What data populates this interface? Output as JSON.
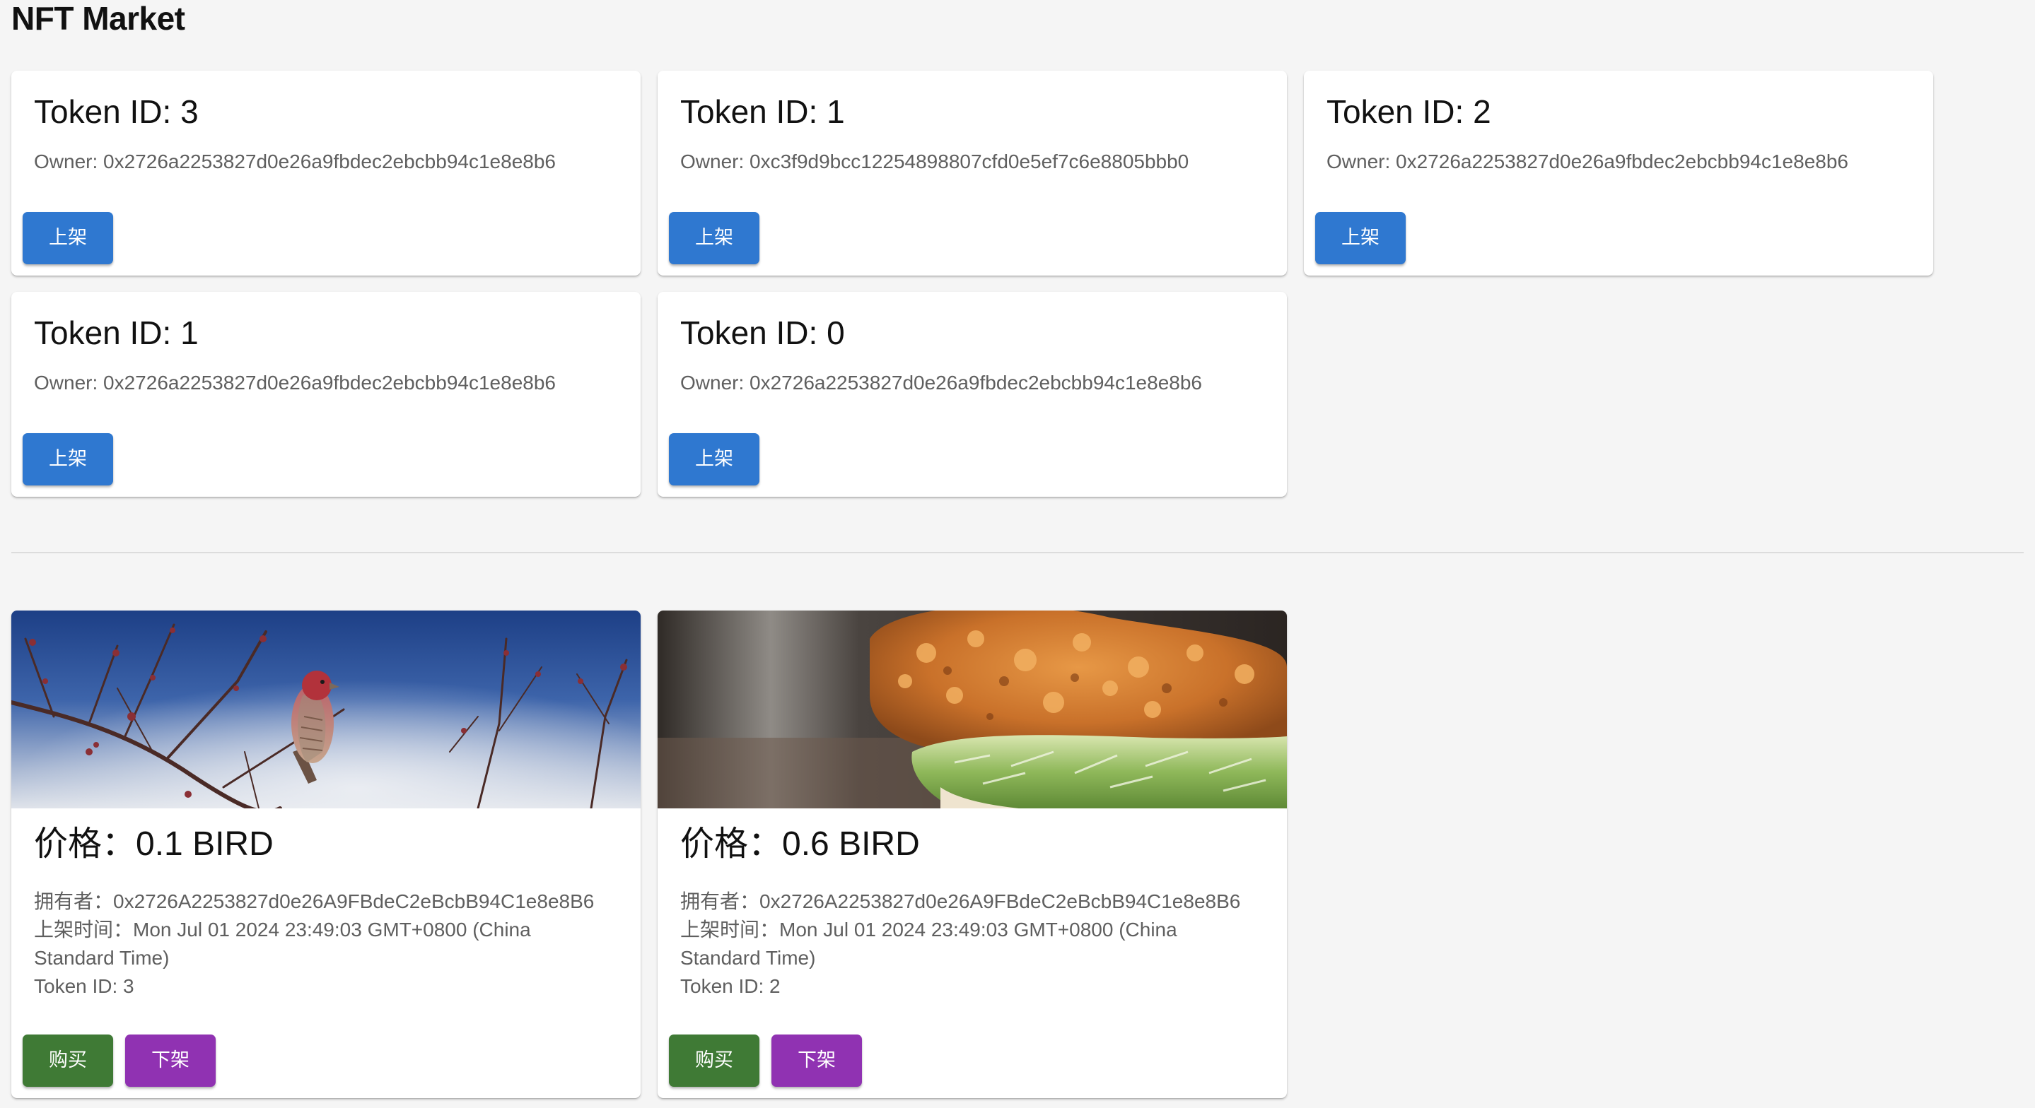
{
  "app": {
    "title": "NFT Market"
  },
  "owned_tokens": [
    {
      "title": "Token ID: 3",
      "owner": "Owner: 0x2726a2253827d0e26a9fbdec2ebcbb94c1e8e8b6",
      "button_label": "上架"
    },
    {
      "title": "Token ID: 1",
      "owner": "Owner: 0xc3f9d9bcc12254898807cfd0e5ef7c6e8805bbb0",
      "button_label": "上架"
    },
    {
      "title": "Token ID: 2",
      "owner": "Owner: 0x2726a2253827d0e26a9fbdec2ebcbb94c1e8e8b6",
      "button_label": "上架"
    },
    {
      "title": "Token ID: 1",
      "owner": "Owner: 0x2726a2253827d0e26a9fbdec2ebcbb94c1e8e8b6",
      "button_label": "上架"
    },
    {
      "title": "Token ID: 0",
      "owner": "Owner: 0x2726a2253827d0e26a9fbdec2ebcbb94c1e8e8b6",
      "button_label": "上架"
    }
  ],
  "listings": [
    {
      "image": "bird-photo",
      "price": "价格：0.1 BIRD",
      "owner": "拥有者：0x2726A2253827d0e26A9FBdeC2eBcbB94C1e8e8B6",
      "listed_time": "上架时间：Mon Jul 01 2024 23:49:03 GMT+0800 (China Standard Time)",
      "token_id": "Token ID: 3",
      "buy_label": "购买",
      "delist_label": "下架"
    },
    {
      "image": "fried-chicken-sandwich-photo",
      "price": "价格：0.6 BIRD",
      "owner": "拥有者：0x2726A2253827d0e26A9FBdeC2eBcbB94C1e8e8B6",
      "listed_time": "上架时间：Mon Jul 01 2024 23:49:03 GMT+0800 (China Standard Time)",
      "token_id": "Token ID: 2",
      "buy_label": "购买",
      "delist_label": "下架"
    }
  ],
  "colors": {
    "list_button": "#2f78d0",
    "buy_button": "#3f7a35",
    "delist_button": "#9032b2",
    "page_background": "#f5f5f5"
  }
}
